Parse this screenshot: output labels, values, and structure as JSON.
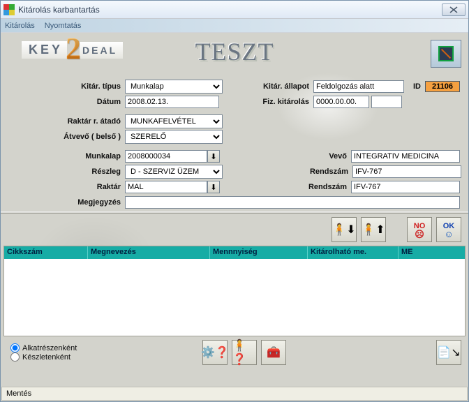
{
  "window": {
    "title": "Kitárolás karbantartás"
  },
  "menu": {
    "item1": "Kitárolás",
    "item2": "Nyomtatás"
  },
  "brand": {
    "part1": "KEY",
    "part2": "2",
    "part3": "DEAL",
    "center": "TESZT"
  },
  "labels": {
    "kitar_tipus": "Kitár. típus",
    "datum": "Dátum",
    "kitar_allapot": "Kitár. állapot",
    "fiz_kitarolas": "Fiz. kitárolás",
    "id": "ID",
    "raktar_atado": "Raktár r. átadó",
    "atvevo": "Átvevő ( belső )",
    "munkalap": "Munkalap",
    "reszleg": "Részleg",
    "raktar": "Raktár",
    "megjegyzes": "Megjegyzés",
    "vevo": "Vevő",
    "rendszam": "Rendszám"
  },
  "fields": {
    "kitar_tipus": "Munkalap",
    "datum": "2008.02.13.",
    "kitar_allapot": "Feldolgozás alatt",
    "fiz_kitarolas": "0000.00.00.",
    "fiz_kitarolas_extra": "",
    "id": "21106",
    "raktar_atado": "MUNKAFELVÉTEL",
    "atvevo": "SZERELŐ",
    "munkalap": "2008000034",
    "reszleg": "D - SZERVIZ ÜZEM",
    "raktar": "MAL",
    "megjegyzes": "",
    "vevo": "INTEGRATIV MEDICINA",
    "rendszam1": "IFV-767",
    "rendszam2": "IFV-767"
  },
  "grid": {
    "cols": {
      "c1": "Cikkszám",
      "c2": "Megnevezés",
      "c3": "Mennnyiség",
      "c4": "Kitárolható me.",
      "c5": "ME"
    }
  },
  "radios": {
    "r1": "Alkatrészenként",
    "r2": "Készletenként"
  },
  "buttons": {
    "no": "NO",
    "ok": "OK"
  },
  "status": "Mentés"
}
